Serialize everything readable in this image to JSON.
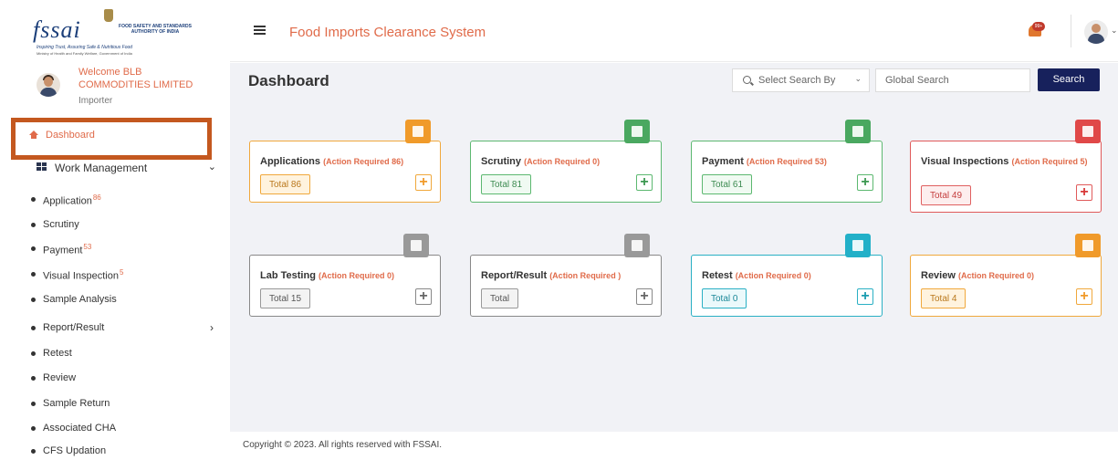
{
  "brand": {
    "logo_text": "fssai",
    "authority": "FOOD SAFETY AND STANDARDS AUTHORITY OF INDIA",
    "tagline": "Inspiring Trust, Assuring Safe & Nutritious Food",
    "ministry": "Ministry of Health and Family Welfare, Government of India"
  },
  "user": {
    "welcome": "Welcome BLB COMMODITIES LIMITED",
    "role": "Importer"
  },
  "sidebar": {
    "dashboard_label": "Dashboard",
    "work_management_label": "Work Management",
    "items": [
      {
        "label": "Application",
        "badge": "86"
      },
      {
        "label": "Scrutiny",
        "badge": ""
      },
      {
        "label": "Payment",
        "badge": "53"
      },
      {
        "label": "Visual Inspection",
        "badge": "5"
      },
      {
        "label": "Sample Analysis",
        "badge": ""
      },
      {
        "label": "Report/Result",
        "badge": ""
      },
      {
        "label": "Retest",
        "badge": ""
      },
      {
        "label": "Review",
        "badge": ""
      },
      {
        "label": "Sample Return",
        "badge": ""
      },
      {
        "label": "Associated CHA",
        "badge": ""
      },
      {
        "label": "CFS Updation",
        "badge": ""
      }
    ]
  },
  "header": {
    "app_title": "Food Imports Clearance System",
    "notification_badge": "99+"
  },
  "main": {
    "page_title": "Dashboard",
    "search_by_value": "Select Search By",
    "global_search_placeholder": "Global Search",
    "search_button": "Search",
    "cards": [
      {
        "title": "Applications",
        "req": "(Action Required 86)",
        "total": "Total 86",
        "color": "#f09a2a"
      },
      {
        "title": "Scrutiny",
        "req": "(Action Required 0)",
        "total": "Total 81",
        "color": "#4aa860"
      },
      {
        "title": "Payment",
        "req": "(Action Required 53)",
        "total": "Total 61",
        "color": "#4aa860"
      },
      {
        "title": "Visual Inspections",
        "req": "(Action Required 5)",
        "total": "Total 49",
        "color": "#e04848"
      },
      {
        "title": "Lab Testing",
        "req": "(Action Required 0)",
        "total": "Total 15",
        "color": "#999999"
      },
      {
        "title": "Report/Result",
        "req": "(Action Required )",
        "total": "Total",
        "color": "#999999"
      },
      {
        "title": "Retest",
        "req": "(Action Required 0)",
        "total": "Total 0",
        "color": "#22b0c8"
      },
      {
        "title": "Review",
        "req": "(Action Required 0)",
        "total": "Total 4",
        "color": "#f09a2a"
      }
    ]
  },
  "footer": {
    "copyright": "Copyright © 2023. All rights reserved with FSSAI."
  }
}
